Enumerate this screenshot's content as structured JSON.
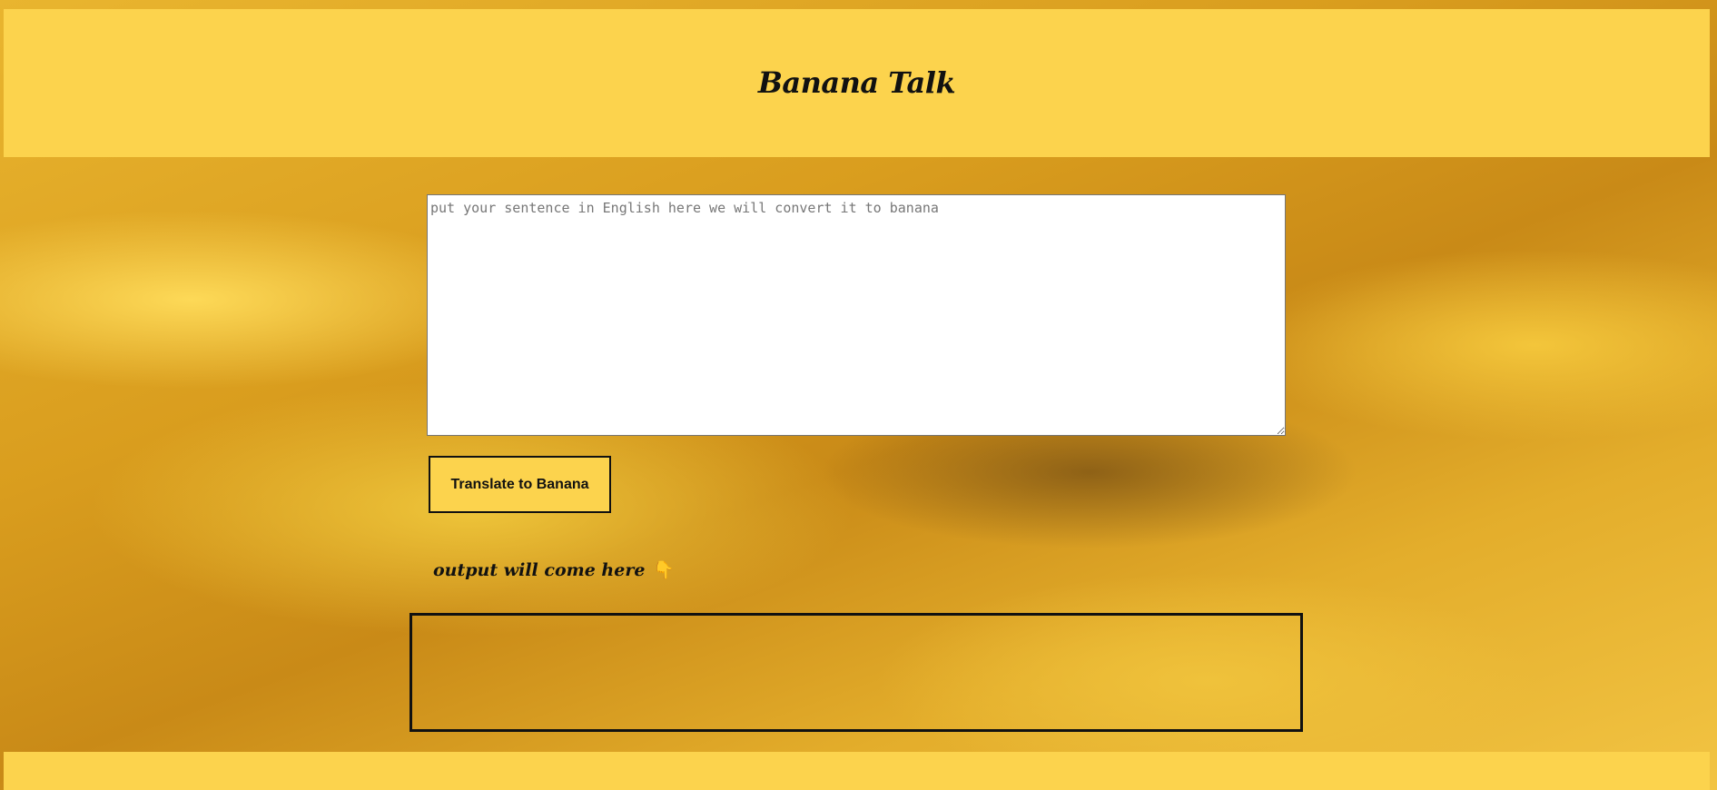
{
  "header": {
    "title": "Banana Talk"
  },
  "input": {
    "value": "",
    "placeholder": "put your sentence in English here we will convert it to banana"
  },
  "translate_button": {
    "label": "Translate to Banana"
  },
  "output": {
    "label": "output will come here",
    "pointer_icon": "👇",
    "value": ""
  },
  "colors": {
    "accent": "#fcd34d",
    "text": "#111111"
  }
}
